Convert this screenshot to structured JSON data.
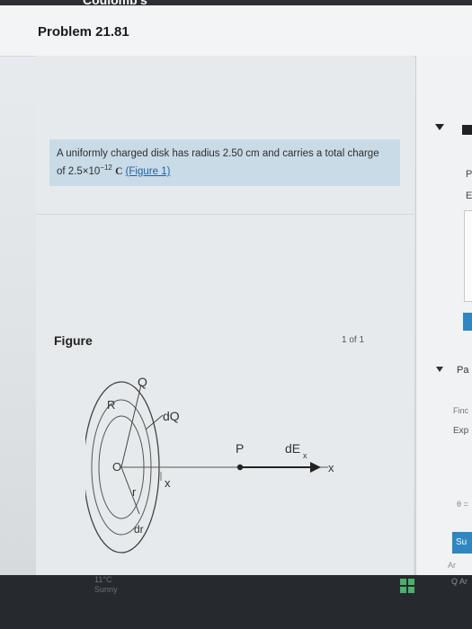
{
  "header": {
    "course_label": "Coulomb's",
    "problem_title": "Problem 21.81"
  },
  "intro": {
    "text_line1": "A uniformly charged disk has radius 2.50 cm and carries a total charge",
    "text_line2_prefix": "of 2.5×10",
    "exponent": "−12",
    "unit": "C",
    "figure_link": "(Figure 1)"
  },
  "figure_panel": {
    "label": "Figure",
    "count": "1 of 1",
    "labels": {
      "Q": "Q",
      "R": "R",
      "dQ": "dQ",
      "O": "O",
      "r": "r",
      "dr": "dr",
      "x": "x",
      "P": "P",
      "dEx": "dE",
      "dEx_sub": "x",
      "x_axis": "x"
    }
  },
  "right_panel": {
    "text_p": "P",
    "text_e": "E",
    "part_label": "Pa",
    "find_text": "Finc",
    "express_text": "Exp",
    "theta_text": "θ =",
    "submit_label": "Su",
    "request_text": "Ar"
  },
  "taskbar": {
    "temperature": "11°C",
    "weather": "Sunny",
    "search_text": "Q Ar"
  },
  "colors": {
    "intro_bg": "#c9dbe6",
    "link": "#1f63a8",
    "accent": "#2f86c0"
  }
}
